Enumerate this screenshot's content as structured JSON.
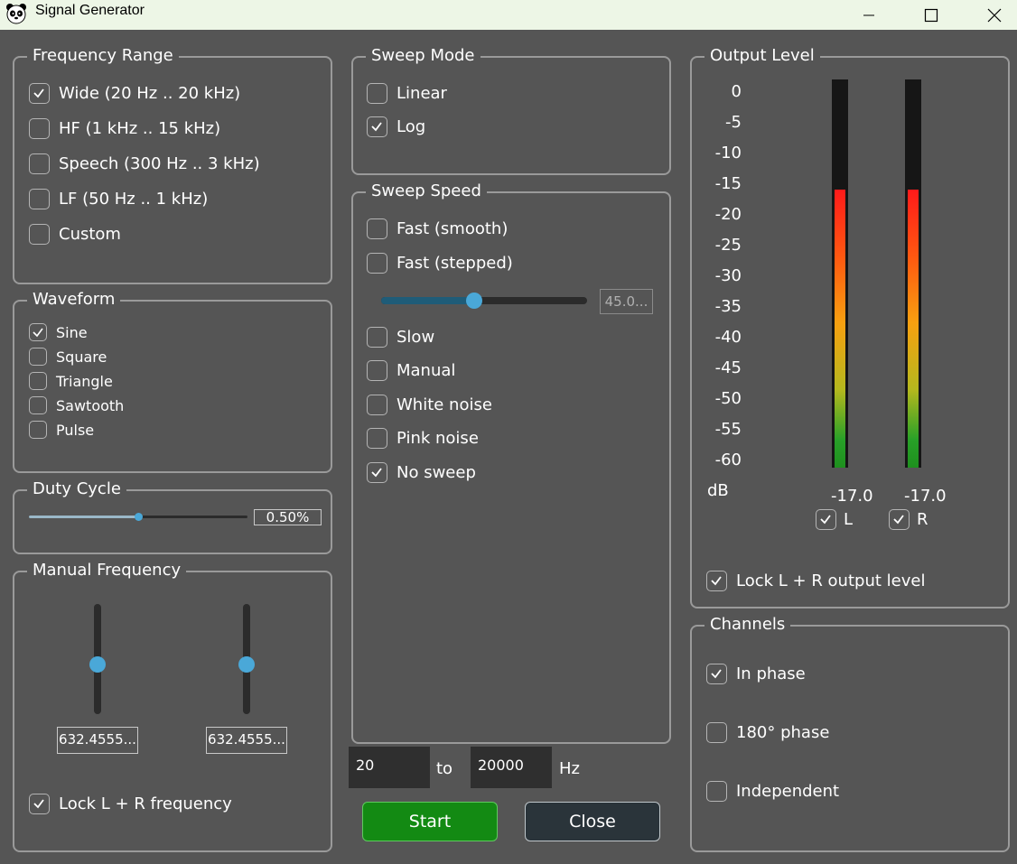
{
  "window": {
    "title": "Signal Generator",
    "app_icon": "panda-icon"
  },
  "frequency_range": {
    "legend": "Frequency Range",
    "options": [
      {
        "label": "Wide (20 Hz .. 20 kHz)",
        "checked": true
      },
      {
        "label": "HF (1 kHz .. 15 kHz)",
        "checked": false
      },
      {
        "label": "Speech (300 Hz .. 3 kHz)",
        "checked": false
      },
      {
        "label": "LF (50 Hz .. 1 kHz)",
        "checked": false
      },
      {
        "label": "Custom",
        "checked": false
      }
    ]
  },
  "waveform": {
    "legend": "Waveform",
    "options": [
      {
        "label": "Sine",
        "checked": true
      },
      {
        "label": "Square",
        "checked": false
      },
      {
        "label": "Triangle",
        "checked": false
      },
      {
        "label": "Sawtooth",
        "checked": false
      },
      {
        "label": "Pulse",
        "checked": false
      }
    ]
  },
  "duty_cycle": {
    "legend": "Duty Cycle",
    "value": "0.50%",
    "slider_fraction": 0.5
  },
  "manual_frequency": {
    "legend": "Manual Frequency",
    "left_value": "632.4555...",
    "right_value": "632.4555...",
    "slider_fraction": 0.5,
    "lock_label": "Lock L + R frequency",
    "lock_checked": true
  },
  "sweep_mode": {
    "legend": "Sweep Mode",
    "options": [
      {
        "label": "Linear",
        "checked": false
      },
      {
        "label": "Log",
        "checked": true
      }
    ]
  },
  "sweep_speed": {
    "legend": "Sweep Speed",
    "options_top": [
      {
        "label": "Fast (smooth)",
        "checked": false
      },
      {
        "label": "Fast (stepped)",
        "checked": false
      }
    ],
    "slider_value": "45.0...",
    "slider_fraction": 0.45,
    "options_bottom": [
      {
        "label": "Slow",
        "checked": false
      },
      {
        "label": "Manual",
        "checked": false
      },
      {
        "label": "White noise",
        "checked": false
      },
      {
        "label": "Pink noise",
        "checked": false
      },
      {
        "label": "No sweep",
        "checked": true
      }
    ]
  },
  "range": {
    "from": "20",
    "to_label": "to",
    "to": "20000",
    "unit": "Hz"
  },
  "buttons": {
    "start": "Start",
    "close": "Close",
    "start_color": "#138a13",
    "close_color": "#2a343a"
  },
  "output_level": {
    "legend": "Output Level",
    "scale": [
      "0",
      "-5",
      "-10",
      "-15",
      "-20",
      "-25",
      "-30",
      "-35",
      "-40",
      "-45",
      "-50",
      "-55",
      "-60"
    ],
    "unit": "dB",
    "left_value": "-17.0",
    "right_value": "-17.0",
    "left_label": "L",
    "right_label": "R",
    "left_checked": true,
    "right_checked": true,
    "lock_label": "Lock L + R output level",
    "lock_checked": true
  },
  "channels": {
    "legend": "Channels",
    "options": [
      {
        "label": "In phase",
        "checked": true
      },
      {
        "label": "180° phase",
        "checked": false
      },
      {
        "label": "Independent",
        "checked": false
      }
    ]
  }
}
